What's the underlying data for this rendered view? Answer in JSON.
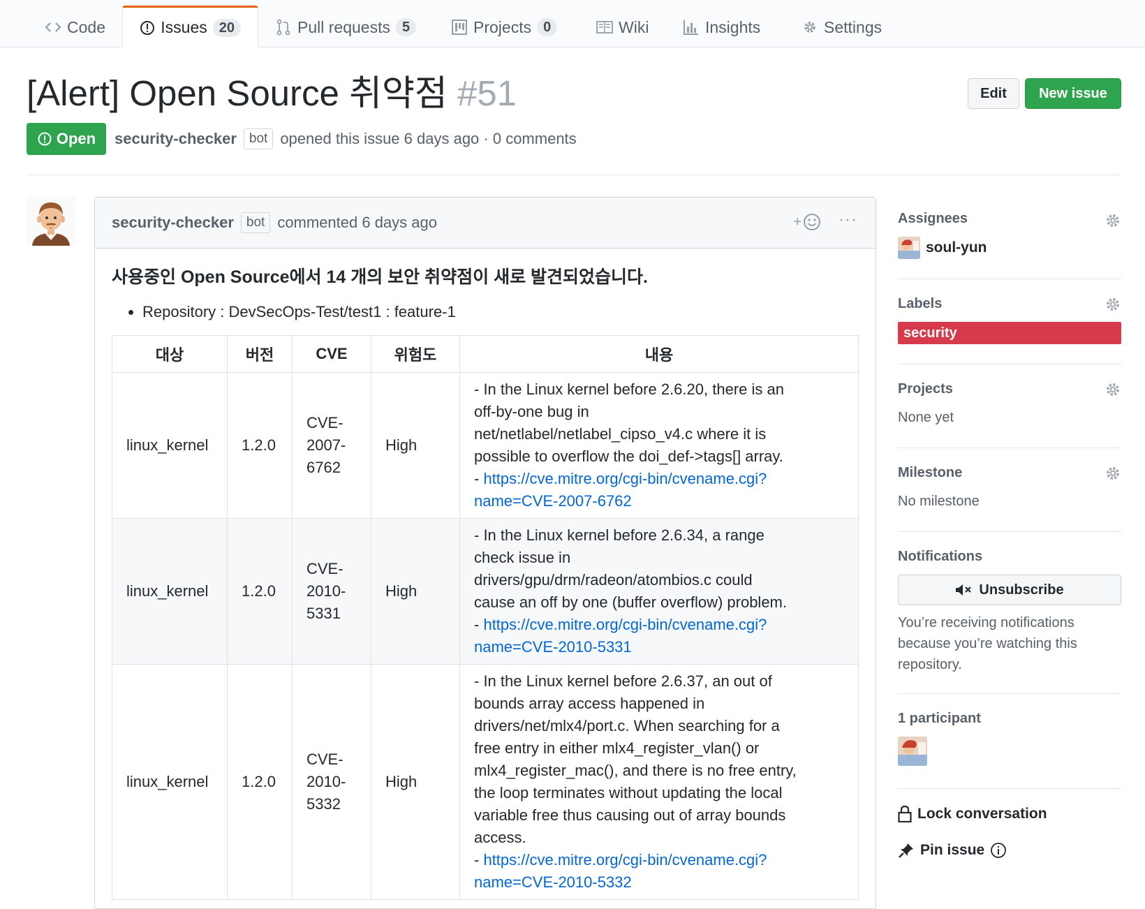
{
  "nav": {
    "tabs": [
      {
        "label": "Code",
        "icon": "code-icon"
      },
      {
        "label": "Issues",
        "counter": "20",
        "icon": "issue-opened-icon",
        "selected": true
      },
      {
        "label": "Pull requests",
        "counter": "5",
        "icon": "git-pull-request-icon"
      },
      {
        "label": "Projects",
        "counter": "0",
        "icon": "project-icon"
      },
      {
        "label": "Wiki",
        "icon": "book-icon"
      },
      {
        "label": "Insights",
        "icon": "graph-icon"
      },
      {
        "label": "Settings",
        "icon": "gear-icon"
      }
    ]
  },
  "issue": {
    "title": "[Alert] Open Source 취약점",
    "number": "#51",
    "edit_label": "Edit",
    "new_issue_label": "New issue",
    "state": "Open",
    "author": "security-checker",
    "bot_badge": "bot",
    "meta_text": "opened this issue 6 days ago · 0 comments"
  },
  "comment": {
    "author": "security-checker",
    "bot_badge": "bot",
    "time_text": "commented 6 days ago",
    "reaction_plus": "+",
    "more": "···",
    "heading": "사용중인 Open Source에서 14 개의 보안 취약점이 새로 발견되었습니다.",
    "bullet": "Repository : DevSecOps-Test/test1 : feature-1",
    "table": {
      "headers": [
        "대상",
        "버전",
        "CVE",
        "위험도",
        "내용"
      ],
      "rows": [
        {
          "target": "linux_kernel",
          "version": "1.2.0",
          "cve": [
            "CVE-",
            "2007-",
            "6762"
          ],
          "risk": "High",
          "desc": [
            "- In the Linux kernel before 2.6.20, there is an",
            "off-by-one bug in",
            "net/netlabel/netlabel_cipso_v4.c where it is",
            "possible to overflow the doi_def->tags[] array."
          ],
          "link_prefix": "- ",
          "link": [
            "https://cve.mitre.org/cgi-bin/cvename.cgi?",
            "name=CVE-2007-6762"
          ]
        },
        {
          "target": "linux_kernel",
          "version": "1.2.0",
          "cve": [
            "CVE-",
            "2010-",
            "5331"
          ],
          "risk": "High",
          "desc": [
            "- In the Linux kernel before 2.6.34, a range",
            "check issue in",
            "drivers/gpu/drm/radeon/atombios.c could",
            "cause an off by one (buffer overflow) problem."
          ],
          "link_prefix": "- ",
          "link": [
            "https://cve.mitre.org/cgi-bin/cvename.cgi?",
            "name=CVE-2010-5331"
          ]
        },
        {
          "target": "linux_kernel",
          "version": "1.2.0",
          "cve": [
            "CVE-",
            "2010-",
            "5332"
          ],
          "risk": "High",
          "desc": [
            "- In the Linux kernel before 2.6.37, an out of",
            "bounds array access happened in",
            "drivers/net/mlx4/port.c. When searching for a",
            "free entry in either mlx4_register_vlan() or",
            "mlx4_register_mac(), and there is no free entry,",
            "the loop terminates without updating the local",
            "variable free thus causing out of array bounds",
            "access."
          ],
          "link_prefix": "- ",
          "link": [
            "https://cve.mitre.org/cgi-bin/cvename.cgi?",
            "name=CVE-2010-5332"
          ]
        }
      ]
    }
  },
  "sidebar": {
    "assignees": {
      "heading": "Assignees",
      "user": "soul-yun"
    },
    "labels": {
      "heading": "Labels",
      "label": "security",
      "label_color": "#d73a4a"
    },
    "projects": {
      "heading": "Projects",
      "value": "None yet"
    },
    "milestone": {
      "heading": "Milestone",
      "value": "No milestone"
    },
    "notifications": {
      "heading": "Notifications",
      "button": "Unsubscribe",
      "note": "You’re receiving notifications because you’re watching this repository."
    },
    "participants": {
      "heading": "1 participant"
    },
    "lock": "Lock conversation",
    "pin": "Pin issue"
  },
  "colors": {
    "green": "#2ea44f",
    "tab_accent": "#e36209",
    "link": "#0366d6",
    "label_red": "#d73a4a"
  }
}
